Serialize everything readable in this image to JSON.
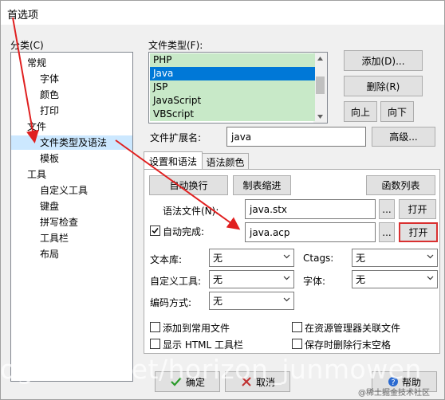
{
  "window": {
    "title": "首选项"
  },
  "tree": {
    "label": "分类(C)",
    "items": [
      {
        "label": "常规",
        "level": 0
      },
      {
        "label": "字体",
        "level": 1
      },
      {
        "label": "颜色",
        "level": 1
      },
      {
        "label": "打印",
        "level": 1
      },
      {
        "label": "文件",
        "level": 0
      },
      {
        "label": "文件类型及语法",
        "level": 1,
        "selected": true
      },
      {
        "label": "模板",
        "level": 1
      },
      {
        "label": "工具",
        "level": 0
      },
      {
        "label": "自定义工具",
        "level": 1
      },
      {
        "label": "键盘",
        "level": 1
      },
      {
        "label": "拼写检查",
        "level": 1
      },
      {
        "label": "工具栏",
        "level": 1
      },
      {
        "label": "布局",
        "level": 1
      }
    ]
  },
  "filetypes": {
    "label": "文件类型(F):",
    "items": [
      "PHP",
      "Java",
      "JSP",
      "JavaScript",
      "VBScript"
    ],
    "selected": "Java",
    "buttons": {
      "add": "添加(D)...",
      "delete": "删除(R)",
      "up": "向上",
      "down": "向下"
    }
  },
  "extension": {
    "label": "文件扩展名:",
    "value": "java",
    "advanced": "高级..."
  },
  "tabs": [
    "设置和语法",
    "语法颜色"
  ],
  "settings": {
    "auto_wrap": "自动换行",
    "tab_indent": "制表缩进",
    "func_list": "函数列表",
    "syntax_label": "语法文件(N):",
    "syntax_value": "java.stx",
    "browse": "...",
    "open": "打开",
    "autocomplete_label": "自动完成:",
    "autocomplete_value": "java.acp",
    "autocomplete_checked": true,
    "library_label": "文本库:",
    "library_value": "无",
    "ctags_label": "Ctags:",
    "ctags_value": "无",
    "custom_tool_label": "自定义工具:",
    "custom_tool_value": "无",
    "font_label": "字体:",
    "font_value": "无",
    "encoding_label": "编码方式:",
    "encoding_value": "无",
    "cb_common": "添加到常用文件",
    "cb_explorer": "在资源管理器关联文件",
    "cb_html_toolbar": "显示 HTML 工具栏",
    "cb_trailing": "保存时删除行末空格"
  },
  "footer": {
    "ok": "确定",
    "cancel": "取消",
    "help": "帮助"
  },
  "watermark": "og.csdn.net/horizon_junmowen",
  "watermark2": "@稀土掘金技术社区",
  "colors": {
    "accent": "#0078d7",
    "annotation": "#e02020",
    "list_bg": "#c8e9c8",
    "tree_sel": "#cce8ff"
  }
}
